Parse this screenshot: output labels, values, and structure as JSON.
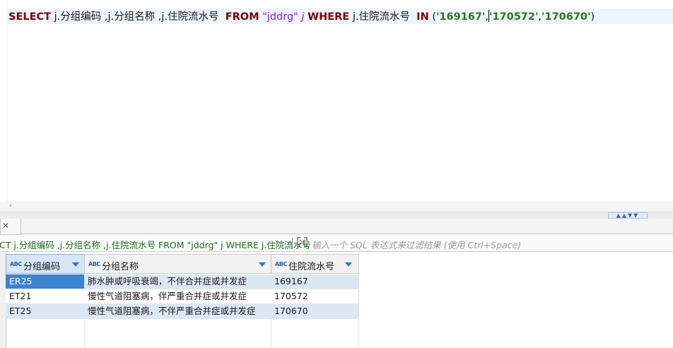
{
  "editor": {
    "kw_select": "SELECT",
    "cols": "j.分组编码 ,j.分组名称 ,j.住院流水号",
    "kw_from": "FROM",
    "table": "\"jddrg\"",
    "alias": "j",
    "kw_where": "WHERE",
    "where_col": "j.住院流水号",
    "kw_in": "IN",
    "open": "(",
    "v1": "'169167'",
    "comma1": ",",
    "v2": "'170572'",
    "comma2": ",",
    "v3": "'170670'",
    "close": ")"
  },
  "scroll_arrow": "‹",
  "sash_glyph": "▲▲▼▼",
  "results": {
    "close_glyph": "✕",
    "filter_query": "CT j.分组编码 ,j.分组名称 ,j.住院流水号 FROM \"jddrg\" j WHERE j.住院流水号",
    "filter_placeholder": "输入一个 SQL 表达式来过滤结果 (使用 Ctrl+Space)",
    "columns": [
      {
        "type": "ABC",
        "label": "分组编码"
      },
      {
        "type": "ABC",
        "label": "分组名称"
      },
      {
        "type": "ABC",
        "label": "住院流水号"
      }
    ],
    "rows": [
      {
        "code": "ER25",
        "name": "肺水肿或呼吸衰竭，不伴合并症或并发症",
        "serial": "169167"
      },
      {
        "code": "ET21",
        "name": "慢性气道阻塞病，伴严重合并症或并发症",
        "serial": "170572"
      },
      {
        "code": "ET25",
        "name": "慢性气道阻塞病，不伴严重合并症或并发症",
        "serial": "170670"
      }
    ]
  },
  "colors": {
    "keyword": "#7f0000",
    "string": "#8c1cc4",
    "number": "#2a7a18",
    "selection": "#3c84d1",
    "row_alt": "#dce7f4"
  }
}
